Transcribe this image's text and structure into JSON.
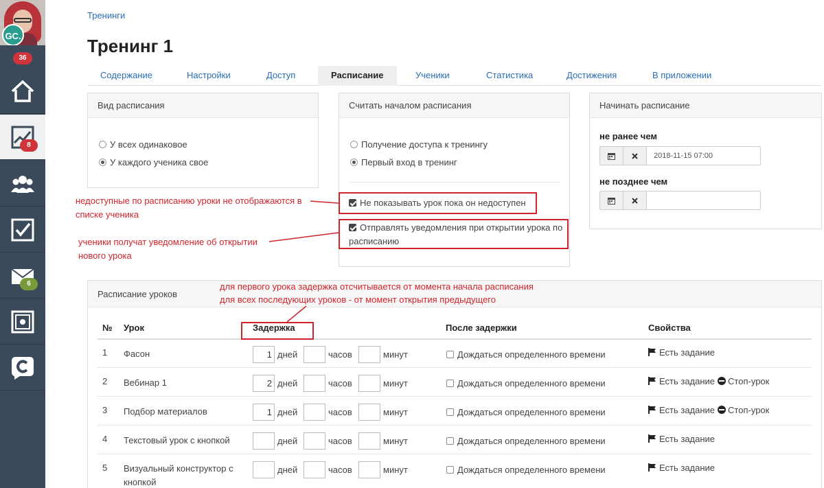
{
  "sidebar": {
    "avatar_initials": "GC.",
    "notifications_count": "36",
    "items": [
      {
        "icon": "home-icon"
      },
      {
        "icon": "chart-icon",
        "badge": "8",
        "badge_color": "#d0343b"
      },
      {
        "icon": "users-icon"
      },
      {
        "icon": "tasks-icon"
      },
      {
        "icon": "mail-icon",
        "badge": "6",
        "badge_color": "#7a9a3a"
      },
      {
        "icon": "safe-icon"
      },
      {
        "icon": "chat-icon"
      }
    ]
  },
  "breadcrumb": "Тренинги",
  "page_title": "Тренинг 1",
  "tabs": [
    {
      "label": "Содержание"
    },
    {
      "label": "Настройки"
    },
    {
      "label": "Доступ"
    },
    {
      "label": "Расписание",
      "active": true
    },
    {
      "label": "Ученики"
    },
    {
      "label": "Статистика"
    },
    {
      "label": "Достижения"
    },
    {
      "label": "В приложении"
    }
  ],
  "schedule_type": {
    "title": "Вид расписания",
    "options": [
      "У всех одинаковое",
      "У каждого ученика свое"
    ],
    "selected": "У каждого ученика свое"
  },
  "schedule_start": {
    "title": "Считать началом расписания",
    "options": [
      "Получение доступа к тренингу",
      "Первый вход в тренинг"
    ],
    "selected": "Первый вход в тренинг",
    "checkboxes": [
      {
        "label": "Не показывать урок пока он недоступен",
        "checked": true
      },
      {
        "label": "Отправлять уведомления при открытии урока по расписанию",
        "checked": true
      }
    ]
  },
  "start_window": {
    "title": "Начинать расписание",
    "not_before_label": "не ранее чем",
    "not_before_value": "2018-11-15 07:00",
    "not_after_label": "не позднее чем",
    "not_after_value": ""
  },
  "annotations": {
    "hidden_lessons": "недоступные по расписанию уроки не отображаются в списке ученика",
    "notifications": "ученики получат уведомление об открытии нового урока",
    "delay_line1": "для первого урока задержка отсчитывается от момента начала расписания",
    "delay_line2": "для всех последующих уроков - от момент открытия предыдущего"
  },
  "lesson_schedule": {
    "title": "Расписание уроков",
    "columns": {
      "num": "№",
      "lesson": "Урок",
      "delay": "Задержка",
      "after": "После задержки",
      "props": "Свойства"
    },
    "units": {
      "days": "дней",
      "hours": "часов",
      "minutes": "минут"
    },
    "wait_label": "Дождаться определенного времени",
    "rows": [
      {
        "num": "1",
        "name": "Фасон",
        "days": "1",
        "hours": "",
        "minutes": "",
        "has_task": "Есть задание",
        "stop": ""
      },
      {
        "num": "2",
        "name": "Вебинар 1",
        "days": "2",
        "hours": "",
        "minutes": "",
        "has_task": "Есть задание",
        "stop": "Стоп-урок"
      },
      {
        "num": "3",
        "name": "Подбор материалов",
        "days": "1",
        "hours": "",
        "minutes": "",
        "has_task": "Есть задание",
        "stop": "Стоп-урок"
      },
      {
        "num": "4",
        "name": "Текстовый урок с кнопкой",
        "days": "",
        "hours": "",
        "minutes": "",
        "has_task": "Есть задание",
        "stop": ""
      },
      {
        "num": "5",
        "name": "Визуальный конструктор с кнопкой",
        "days": "",
        "hours": "",
        "minutes": "",
        "has_task": "Есть задание",
        "stop": ""
      }
    ]
  },
  "colors": {
    "sidebar": "#3b4a5a",
    "link": "#2a6eb4",
    "annotation": "#d0242c"
  }
}
